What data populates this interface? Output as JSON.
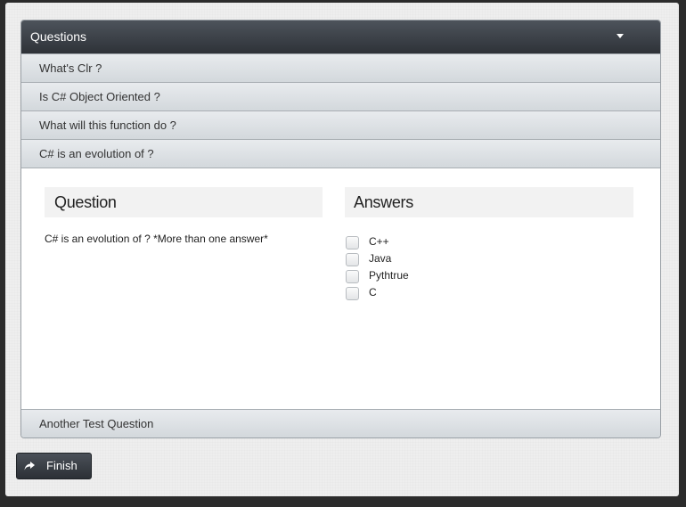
{
  "accordion": {
    "header": "Questions",
    "items": [
      {
        "label": "What's Clr ?"
      },
      {
        "label": "Is C# Object Oriented ?"
      },
      {
        "label": "What will this function do ?"
      },
      {
        "label": "C# is an evolution of ?"
      }
    ],
    "last_item": {
      "label": "Another Test Question"
    }
  },
  "content": {
    "question_heading": "Question",
    "answers_heading": "Answers",
    "question_text": "C# is an evolution of ? *More than one answer*",
    "answers": [
      {
        "label": "C++",
        "checked": false
      },
      {
        "label": "Java",
        "checked": false
      },
      {
        "label": "Pythtrue",
        "checked": false
      },
      {
        "label": "C",
        "checked": false
      }
    ]
  },
  "footer": {
    "finish_label": "Finish",
    "finish_icon": "share-arrow-icon"
  }
}
